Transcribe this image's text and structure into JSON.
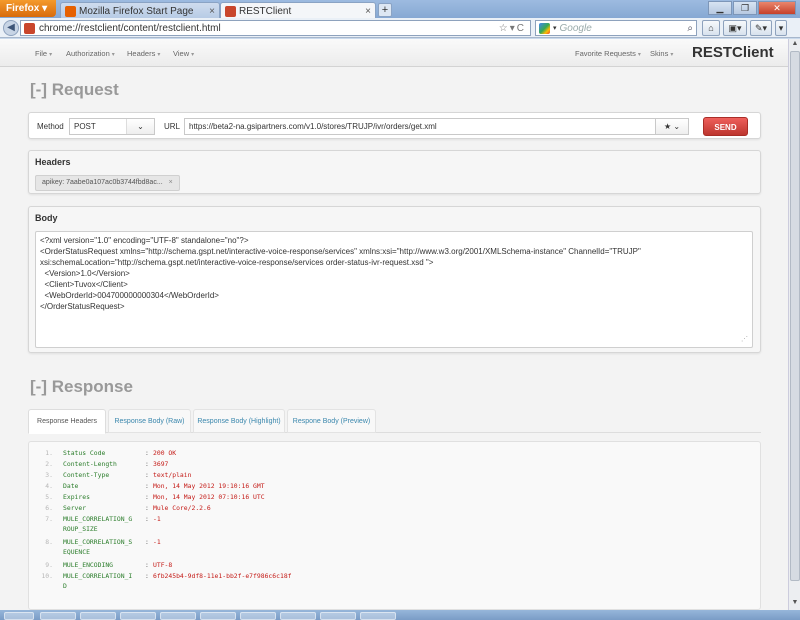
{
  "browser": {
    "menu_button": "Firefox",
    "tabs": [
      {
        "title": "Mozilla Firefox Start Page",
        "color": "#e66000"
      },
      {
        "title": "RESTClient",
        "color": "#c9462c"
      }
    ],
    "new_tab": "+",
    "url": "chrome://restclient/content/restclient.html",
    "search_engine": "Google",
    "search_placeholder": "Google"
  },
  "app": {
    "brand": "RESTClient",
    "menu_left": [
      "File",
      "Authorization",
      "Headers",
      "View"
    ],
    "menu_right": [
      "Favorite Requests",
      "Skins"
    ]
  },
  "request": {
    "section_title": "[-] Request",
    "method_label": "Method",
    "method_value": "POST",
    "url_label": "URL",
    "url_value": "https://beta2-na.gsipartners.com/v1.0/stores/TRUJP/ivr/orders/get.xml",
    "send_label": "SEND",
    "send_color": "#da4f49",
    "headers_title": "Headers",
    "header_chip": "apikey: 7aabe0a107ac0b3744fbd8ac...",
    "body_title": "Body",
    "body_lines": [
      "<?xml version=\"1.0\" encoding=\"UTF-8\" standalone=\"no\"?>",
      "<OrderStatusRequest xmlns=\"http://schema.gspt.net/interactive-voice-response/services\" xmlns:xsi=\"http://www.w3.org/2001/XMLSchema-instance\" ChannelId=\"TRUJP\"",
      "xsi:schemaLocation=\"http://schema.gspt.net/interactive-voice-response/services order-status-ivr-request.xsd \">",
      "  <Version>1.0</Version>",
      "  <Client>Tuvox</Client>",
      "  <WebOrderId>004700000000304</WebOrderId>",
      "</OrderStatusRequest>"
    ]
  },
  "response": {
    "section_title": "[-] Response",
    "tabs": [
      "Response Headers",
      "Response Body (Raw)",
      "Response Body (Highlight)",
      "Respone Body (Preview)"
    ],
    "rows": [
      {
        "num": "1.",
        "key": "Status Code",
        "val": "200 OK"
      },
      {
        "num": "2.",
        "key": "Content-Length",
        "val": "3697"
      },
      {
        "num": "3.",
        "key": "Content-Type",
        "val": "text/plain"
      },
      {
        "num": "4.",
        "key": "Date",
        "val": "Mon, 14 May 2012 19:10:16 GMT"
      },
      {
        "num": "5.",
        "key": "Expires",
        "val": "Mon, 14 May 2012 07:10:16 UTC"
      },
      {
        "num": "6.",
        "key": "Server",
        "val": "Mule Core/2.2.6"
      },
      {
        "num": "7.",
        "key": "MULE_CORRELATION_G\nROUP_SIZE",
        "val": "-1"
      },
      {
        "num": "8.",
        "key": "MULE_CORRELATION_S\nEQUENCE",
        "val": "-1"
      },
      {
        "num": "9.",
        "key": "MULE_ENCODING",
        "val": "UTF-8"
      },
      {
        "num": "10.",
        "key": "MULE_CORRELATION_I\nD",
        "val": "6fb245b4-9df8-11e1-bb2f-e7f986c6c18f"
      }
    ]
  }
}
